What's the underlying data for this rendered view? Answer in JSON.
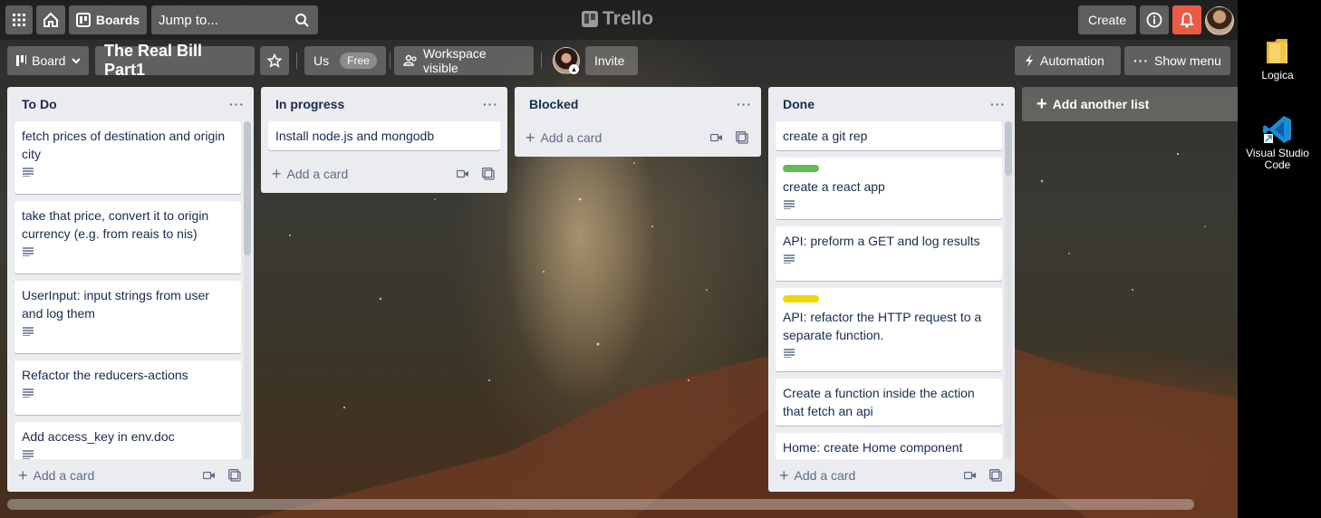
{
  "app": {
    "logo_text": "Trello",
    "boards_label": "Boards",
    "jump_placeholder": "Jump to...",
    "create_label": "Create"
  },
  "board": {
    "view_label": "Board",
    "title": "The Real Bill Part1",
    "workspace_label": "Us",
    "plan_badge": "Free",
    "visibility_label": "Workspace visible",
    "invite_label": "Invite",
    "automation_label": "Automation",
    "menu_label": "Show menu",
    "add_list_label": "Add another list"
  },
  "lists": [
    {
      "name": "To Do",
      "add_card_label": "Add a card",
      "cards": [
        {
          "title": "fetch prices of destination and origin city",
          "has_description": true
        },
        {
          "title": "take that price, convert it to origin currency (e.g. from reais to nis)",
          "has_description": true
        },
        {
          "title": "UserInput: input strings from user and log them",
          "has_description": true
        },
        {
          "title": "Refactor the reducers-actions",
          "has_description": true
        },
        {
          "title": "Add access_key in env.doc",
          "has_description": true
        }
      ]
    },
    {
      "name": "In progress",
      "add_card_label": "Add a card",
      "cards": [
        {
          "title": "Install node.js and mongodb",
          "has_description": false
        }
      ]
    },
    {
      "name": "Blocked",
      "add_card_label": "Add a card",
      "cards": []
    },
    {
      "name": "Done",
      "add_card_label": "Add a card",
      "cards": [
        {
          "title": "create a git rep",
          "has_description": false
        },
        {
          "title": "create a react app",
          "has_description": true,
          "label_color": "#61bd4f"
        },
        {
          "title": "API: preform a GET and log results",
          "has_description": true
        },
        {
          "title": "API: refactor the HTTP request to a separate function.",
          "has_description": true,
          "label_color": "#f2d600"
        },
        {
          "title": "Create a function inside the action that fetch an api",
          "has_description": false
        },
        {
          "title": "Home: create Home component",
          "has_description": false
        }
      ]
    }
  ],
  "desktop": {
    "icons": [
      {
        "label": "Logica",
        "icon": "folder-icon"
      },
      {
        "label": "Visual Studio Code",
        "icon": "vscode-icon"
      }
    ]
  },
  "colors": {
    "list_bg": "#ebecf0",
    "notification": "#eb5a46",
    "label_green": "#61bd4f",
    "label_yellow": "#f2d600"
  }
}
